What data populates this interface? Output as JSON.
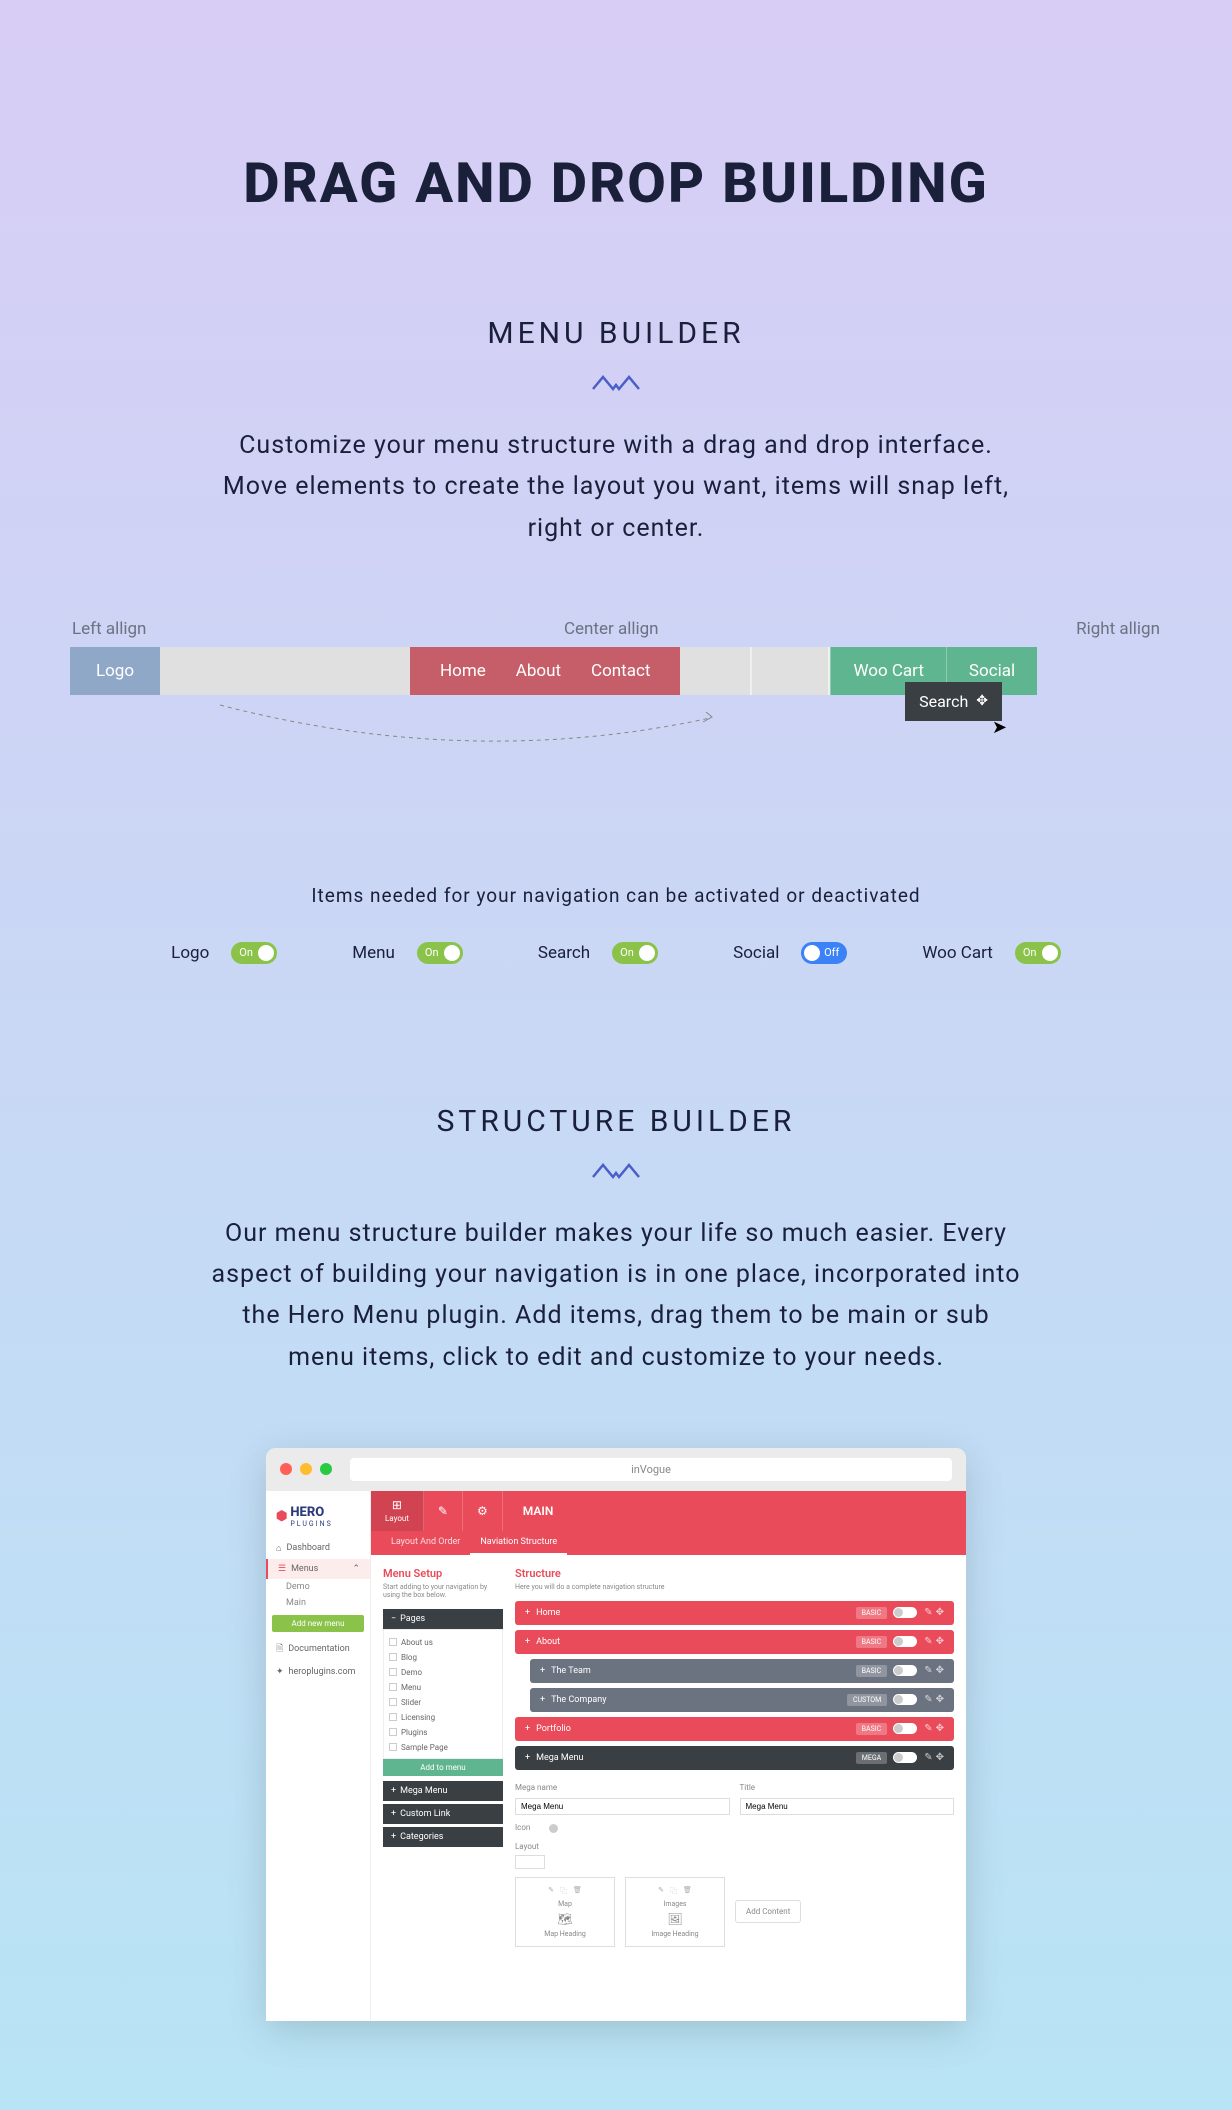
{
  "mainTitle": "DRAG AND DROP BUILDING",
  "section1": {
    "title": "MENU BUILDER",
    "desc": "Customize your menu structure with a drag and drop interface. Move elements to create the layout you want, items will snap left, right or center.",
    "alignLabels": {
      "left": "Left allign",
      "center": "Center allign",
      "right": "Right allign"
    },
    "logo": "Logo",
    "nav": [
      "Home",
      "About",
      "Contact"
    ],
    "search": "Search",
    "wooCart": "Woo Cart",
    "social": "Social",
    "activationText": "Items needed for your navigation can be activated or deactivated",
    "toggles": [
      {
        "label": "Logo",
        "state": "on",
        "text": "On"
      },
      {
        "label": "Menu",
        "state": "on",
        "text": "On"
      },
      {
        "label": "Search",
        "state": "on",
        "text": "On"
      },
      {
        "label": "Social",
        "state": "off",
        "text": "Off"
      },
      {
        "label": "Woo Cart",
        "state": "on",
        "text": "On"
      }
    ]
  },
  "section2": {
    "title": "STRUCTURE BUILDER",
    "desc": "Our menu structure builder makes your life so much easier. Every aspect of building your navigation is in one place, incorporated into the Hero Menu plugin. Add items, drag them to be main or sub menu items, click to edit and customize to your needs."
  },
  "browser": {
    "url": "inVogue",
    "logo": {
      "main": "HERO",
      "sub": "PLUGINS"
    },
    "sidebar": {
      "dashboard": "Dashboard",
      "menus": "Menus",
      "demo": "Demo",
      "main": "Main",
      "addNew": "Add new menu",
      "docs": "Documentation",
      "site": "heroplugins.com"
    },
    "toolbar": {
      "layout": "Layout",
      "main": "MAIN"
    },
    "subTabs": [
      "Layout And Order",
      "Naviation Structure"
    ],
    "menuSetup": {
      "title": "Menu Setup",
      "desc": "Start adding to your navigation by using the box below.",
      "pagesHeader": "Pages",
      "pages": [
        "About us",
        "Blog",
        "Demo",
        "Menu",
        "Slider",
        "Licensing",
        "Plugins",
        "Sample Page"
      ],
      "addToMenu": "Add to menu",
      "megaMenu": "Mega Menu",
      "customLink": "Custom Link",
      "categories": "Categories"
    },
    "structure": {
      "title": "Structure",
      "desc": "Here you will do a complete navigation structure",
      "items": [
        {
          "name": "Home",
          "type": "red",
          "badge": "BASIC"
        },
        {
          "name": "About",
          "type": "red",
          "badge": "BASIC"
        },
        {
          "name": "The Team",
          "type": "gray",
          "badge": "BASIC"
        },
        {
          "name": "The Company",
          "type": "gray",
          "badge": "CUSTOM"
        },
        {
          "name": "Portfolio",
          "type": "red",
          "badge": "BASIC"
        },
        {
          "name": "Mega Menu",
          "type": "dark",
          "badge": "MEGA"
        }
      ],
      "form": {
        "megaNameLabel": "Mega name",
        "megaNameVal": "Mega Menu",
        "titleLabel": "Title",
        "titleVal": "Mega Menu",
        "iconLabel": "Icon",
        "layoutLabel": "Layout"
      },
      "layoutBoxes": [
        {
          "title": "Map",
          "sub": "Map Heading"
        },
        {
          "title": "Images",
          "sub": "Image Heading"
        }
      ],
      "addContent": "Add Content"
    }
  }
}
